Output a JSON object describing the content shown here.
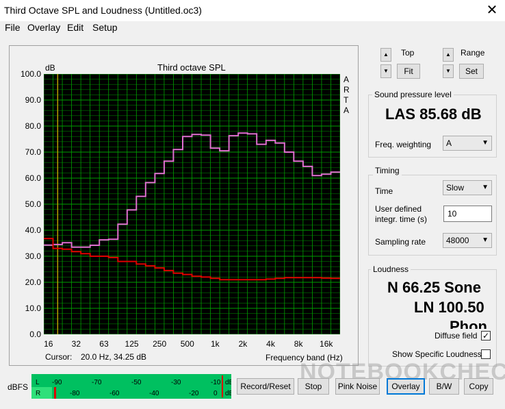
{
  "window": {
    "title": "Third Octave SPL and Loudness (Untitled.oc3)",
    "close_glyph": "✕"
  },
  "menu": [
    "File",
    "Overlay",
    "Edit",
    "Setup"
  ],
  "plot": {
    "db_unit": "dB",
    "arta": [
      "A",
      "R",
      "T",
      "A"
    ],
    "cursor_label": "Cursor:",
    "cursor_value": "20.0 Hz, 34.25 dB",
    "colors": {
      "background": "#000000",
      "grid": "#00a000",
      "cursor": "#b8a000",
      "series1": "#e070d0",
      "series2": "#e00000"
    }
  },
  "chart_data": {
    "type": "line",
    "title": "Third octave SPL",
    "xlabel": "Frequency band (Hz)",
    "ylabel": "dB",
    "ylim": [
      0,
      100
    ],
    "yticks": [
      "100.0",
      "90.0",
      "80.0",
      "70.0",
      "60.0",
      "50.0",
      "40.0",
      "30.0",
      "20.0",
      "10.0",
      "0.0"
    ],
    "xtick_labels": [
      "16",
      "32",
      "63",
      "125",
      "250",
      "500",
      "1k",
      "2k",
      "4k",
      "8k",
      "16k"
    ],
    "bands": [
      "16",
      "20",
      "25",
      "31.5",
      "40",
      "50",
      "63",
      "80",
      "100",
      "125",
      "160",
      "200",
      "250",
      "315",
      "400",
      "500",
      "630",
      "800",
      "1k",
      "1.25k",
      "1.6k",
      "2k",
      "2.5k",
      "3.15k",
      "4k",
      "5k",
      "6.3k",
      "8k",
      "10k",
      "12.5k",
      "16k",
      "20k"
    ],
    "cursor_x_band": "20",
    "grid": true,
    "series": [
      {
        "values": [
          34.3,
          34.5,
          35.2,
          33.5,
          33.5,
          34.2,
          36.3,
          36.5,
          42.3,
          47.8,
          53.0,
          58.3,
          61.8,
          66.5,
          71.0,
          76.0,
          76.8,
          76.5,
          71.5,
          70.5,
          76.3,
          77.3,
          77.0,
          73.0,
          74.5,
          73.5,
          70.0,
          66.5,
          64.5,
          61.0,
          61.5,
          62.3
        ]
      },
      {
        "values": [
          36.8,
          33.0,
          32.7,
          31.8,
          31.0,
          30.0,
          30.0,
          29.5,
          28.0,
          28.0,
          27.0,
          26.3,
          25.5,
          24.5,
          23.5,
          23.0,
          22.3,
          22.0,
          21.5,
          21.0,
          21.0,
          21.0,
          21.0,
          21.0,
          21.2,
          21.5,
          21.8,
          21.8,
          21.8,
          21.8,
          21.6,
          21.5
        ]
      }
    ]
  },
  "controls": {
    "top_label": "Top",
    "range_label": "Range",
    "fit_label": "Fit",
    "set_label": "Set",
    "up_glyph": "▲",
    "down_glyph": "▼"
  },
  "spl": {
    "group_title": "Sound pressure level",
    "value": "LAS 85.68 dB",
    "freq_weighting_label": "Freq. weighting",
    "freq_weighting_value": "A"
  },
  "timing": {
    "group_title": "Timing",
    "time_label": "Time",
    "time_value": "Slow",
    "user_time_label_1": "User defined",
    "user_time_label_2": "integr. time (s)",
    "user_time_value": "10",
    "sampling_rate_label": "Sampling rate",
    "sampling_rate_value": "48000"
  },
  "loudness": {
    "group_title": "Loudness",
    "n_value": "N 66.25 Sone",
    "ln_value": "LN 100.50",
    "phon_value": "Phon",
    "diffuse_label": "Diffuse field",
    "diffuse_checked": "✓",
    "specific_label": "Show Specific Loudness"
  },
  "meter": {
    "label": "dBFS",
    "top_ticks": [
      "L",
      "-90",
      "-70",
      "-50",
      "-30",
      "-10",
      "dB"
    ],
    "bottom_ticks": [
      "R",
      "-80",
      "-60",
      "-40",
      "-20",
      "0",
      "dB"
    ],
    "colors": {
      "bar": "#00c060",
      "level": "#2ee07a",
      "peak": "#e00000"
    }
  },
  "buttons": {
    "record_reset": "Record/Reset",
    "stop": "Stop",
    "pink_noise": "Pink Noise",
    "overlay": "Overlay",
    "bw": "B/W",
    "copy": "Copy"
  },
  "watermark": "NOTEBOOKCHECK"
}
